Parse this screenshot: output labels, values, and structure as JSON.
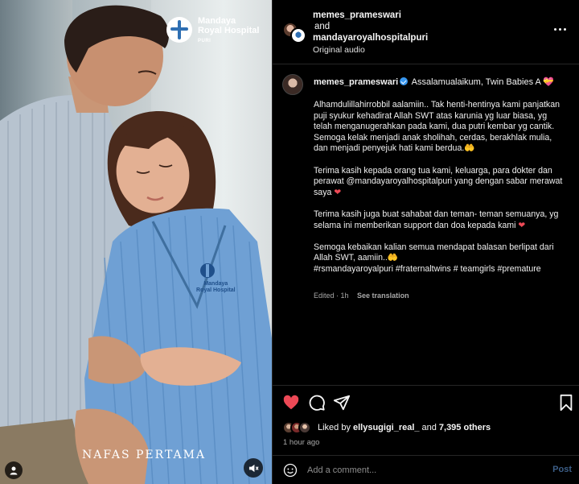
{
  "media": {
    "hospital_logo": {
      "line1": "Mandaya",
      "line2": "Royal Hospital",
      "line3": "PURI"
    },
    "gown_logo": {
      "line1": "Mandaya",
      "line2": "Royal Hospital"
    },
    "overlay_caption": "NAFAS PERTAMA",
    "tag_icon": "person-icon",
    "mute_icon": "speaker-muted-icon"
  },
  "header": {
    "user1": "memes_prameswari",
    "connector": "and",
    "user2": "mandayaroyalhospitalpuri",
    "audio": "Original audio"
  },
  "post": {
    "username": "memes_prameswari",
    "headline": "Assalamualaikum, Twin Babies A",
    "headline_emoji": "💝",
    "paragraphs": [
      "Alhamdulillahirrobbil aalamiin.. Tak henti-hentinya kami panjatkan puji syukur kehadirat Allah SWT atas karunia yg luar biasa, yg telah menganugerahkan pada kami, dua putri kembar yg cantik. Semoga kelak menjadi anak sholihah, cerdas, berakhlak mulia, dan menjadi penyejuk hati kami berdua.",
      "Terima kasih kepada orang tua kami, keluarga, para dokter dan perawat @mandayaroyalhospitalpuri yang dengan sabar merawat saya",
      "Terima kasih juga buat sahabat dan teman- teman semuanya, yg selama ini memberikan support dan doa kepada kami",
      "Semoga kebaikan kalian semua mendapat balasan berlipat dari Allah SWT, aamiin.."
    ],
    "emoji_hands": "🤲",
    "emoji_heart": "❤",
    "hashtags": "#rsmandayaroyalpuri #fraternaltwins # teamgirls #premature",
    "edited": "Edited · 1h",
    "see_translation": "See translation"
  },
  "actions": {
    "liked_by_label": "Liked by",
    "liked_by_user": "ellysugigi_real_",
    "and_label": "and",
    "others": "7,395 others",
    "time": "1 hour ago",
    "comment_placeholder": "Add a comment...",
    "post_label": "Post"
  },
  "colors": {
    "verified": "#3897f0",
    "like_red": "#ed4956",
    "post_button": "#3c5e87"
  }
}
